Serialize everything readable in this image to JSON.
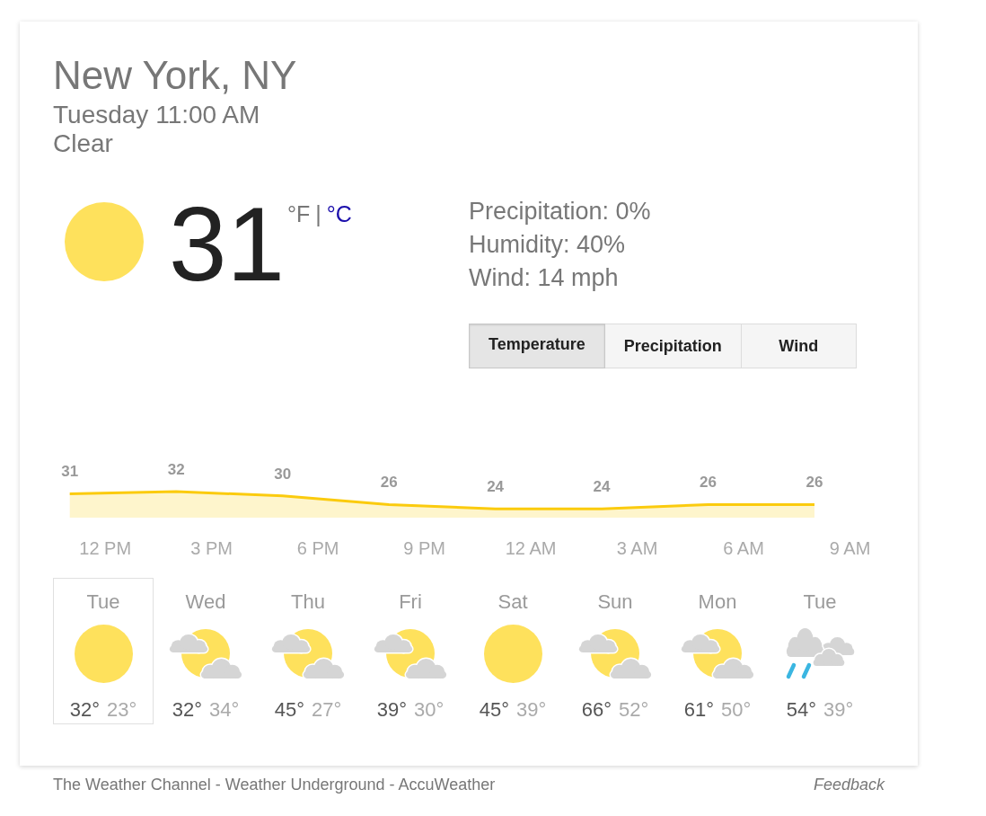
{
  "location": {
    "name": "New York, NY",
    "datetime": "Tuesday 11:00 AM",
    "condition": "Clear"
  },
  "current": {
    "kind": "sunny",
    "temperature": "31",
    "units": [
      {
        "label": "°F",
        "selected": true
      },
      {
        "label": "°C",
        "selected": false
      }
    ],
    "unit_separator": "|",
    "details": [
      "Precipitation: 0%",
      "Humidity: 40%",
      "Wind: 14 mph"
    ]
  },
  "tabs": [
    {
      "label": "Temperature",
      "selected": true
    },
    {
      "label": "Precipitation",
      "selected": false
    },
    {
      "label": "Wind",
      "selected": false
    }
  ],
  "hourly": {
    "chart_data": {
      "type": "area",
      "categories": [
        null,
        "12 PM",
        null,
        null,
        "3 PM",
        null,
        null,
        "6 PM",
        null,
        null,
        "9 PM",
        null,
        null,
        "12 AM",
        null,
        null,
        "3 AM",
        null,
        null,
        "6 AM",
        null,
        null,
        "9 AM"
      ],
      "values": [
        31,
        null,
        null,
        32,
        null,
        null,
        30,
        null,
        null,
        26,
        null,
        null,
        24,
        null,
        null,
        24,
        null,
        null,
        26,
        null,
        null,
        26,
        null
      ],
      "data_labels": true
    }
  },
  "daily": [
    {
      "day": "Tue",
      "kind": "sunny",
      "high": "32°",
      "low": "23°",
      "selected": true
    },
    {
      "day": "Wed",
      "kind": "partly-cloudy",
      "high": "32°",
      "low": "34°",
      "selected": false
    },
    {
      "day": "Thu",
      "kind": "partly-cloudy",
      "high": "45°",
      "low": "27°",
      "selected": false
    },
    {
      "day": "Fri",
      "kind": "partly-cloudy",
      "high": "39°",
      "low": "30°",
      "selected": false
    },
    {
      "day": "Sat",
      "kind": "sunny",
      "high": "45°",
      "low": "39°",
      "selected": false
    },
    {
      "day": "Sun",
      "kind": "partly-cloudy",
      "high": "66°",
      "low": "52°",
      "selected": false
    },
    {
      "day": "Mon",
      "kind": "partly-cloudy",
      "high": "61°",
      "low": "50°",
      "selected": false
    },
    {
      "day": "Tue",
      "kind": "rain",
      "high": "54°",
      "low": "39°",
      "selected": false
    }
  ],
  "footer": {
    "attribution": "The Weather Channel - Weather Underground - AccuWeather",
    "feedback": "Feedback"
  }
}
